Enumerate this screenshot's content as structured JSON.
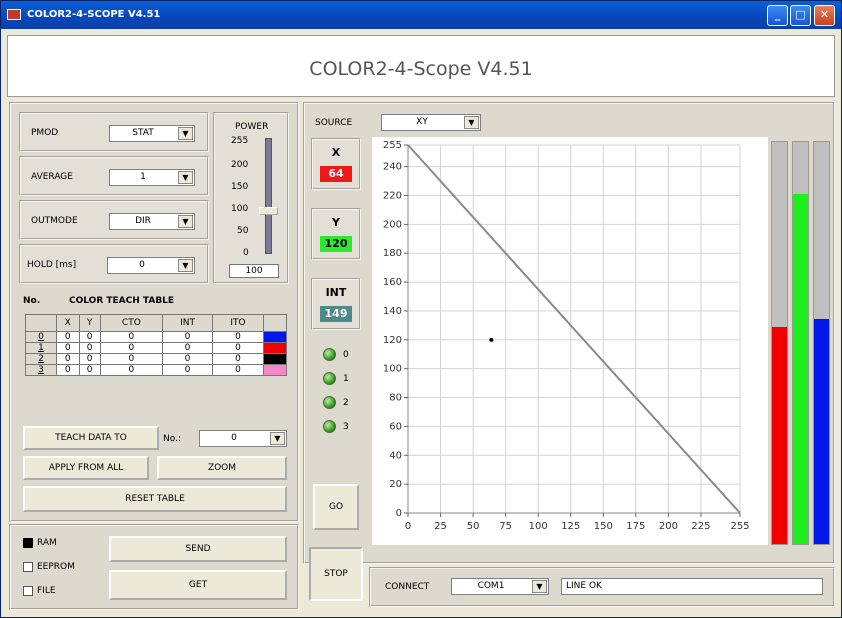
{
  "window": {
    "title": "COLOR2-4-SCOPE V4.51",
    "heading": "COLOR2-4-Scope V4.51"
  },
  "controls": {
    "pmod": {
      "label": "PMOD",
      "value": "STAT"
    },
    "average": {
      "label": "AVERAGE",
      "value": "1"
    },
    "outmode": {
      "label": "OUTMODE",
      "value": "DIR"
    },
    "hold": {
      "label": "HOLD [ms]",
      "value": "0"
    },
    "power": {
      "label": "POWER",
      "ticks": [
        "255",
        "200",
        "150",
        "100",
        "50",
        "0"
      ],
      "value": "100",
      "level": 100
    }
  },
  "teach_table": {
    "title": "COLOR TEACH TABLE",
    "no_label": "No.",
    "columns": [
      "X",
      "Y",
      "CTO",
      "INT",
      "ITO"
    ],
    "rows": [
      {
        "idx": "0",
        "cells": [
          "0",
          "0",
          "0",
          "0",
          "0"
        ],
        "color": "#0018e8"
      },
      {
        "idx": "1",
        "cells": [
          "0",
          "0",
          "0",
          "0",
          "0"
        ],
        "color": "#f00000"
      },
      {
        "idx": "2",
        "cells": [
          "0",
          "0",
          "0",
          "0",
          "0"
        ],
        "color": "#000000"
      },
      {
        "idx": "3",
        "cells": [
          "0",
          "0",
          "0",
          "0",
          "0"
        ],
        "color": "#f28ac8"
      }
    ]
  },
  "buttons": {
    "teach": "TEACH DATA TO",
    "teach_no_label": "No.:",
    "teach_no_value": "0",
    "apply": "APPLY FROM ALL",
    "zoom": "ZOOM",
    "reset": "RESET TABLE",
    "send": "SEND",
    "get": "GET",
    "go": "GO",
    "stop": "STOP"
  },
  "memory": {
    "ram": "RAM",
    "eeprom": "EEPROM",
    "file": "FILE"
  },
  "source": {
    "label": "SOURCE",
    "value": "XY"
  },
  "readouts": {
    "x": {
      "label": "X",
      "value": "64",
      "bg": "#f01818",
      "fg": "#ffffff"
    },
    "y": {
      "label": "Y",
      "value": "120",
      "bg": "#2ee82e",
      "fg": "#000000"
    },
    "int": {
      "label": "INT",
      "value": "149",
      "bg": "#4f8a8a",
      "fg": "#ffffff"
    }
  },
  "leds": [
    "0",
    "1",
    "2",
    "3"
  ],
  "connect": {
    "label": "CONNECT",
    "port": "COM1",
    "status": "LINE OK"
  },
  "chart_data": {
    "type": "scatter",
    "xlim": [
      0,
      255
    ],
    "ylim": [
      0,
      255
    ],
    "xticks": [
      0,
      25,
      50,
      75,
      100,
      125,
      150,
      175,
      200,
      225,
      255
    ],
    "yticks": [
      0,
      20,
      40,
      60,
      80,
      100,
      120,
      140,
      160,
      180,
      200,
      220,
      240,
      255
    ],
    "grid": true,
    "line": {
      "x": [
        0,
        255
      ],
      "y": [
        255,
        0
      ],
      "color": "#8a8a8a"
    },
    "points": [
      {
        "x": 64,
        "y": 120
      }
    ]
  },
  "bars": [
    {
      "color": "#f00000",
      "value": 0.54
    },
    {
      "color": "#1ef01e",
      "value": 0.87
    },
    {
      "color": "#0018e8",
      "value": 0.56
    }
  ]
}
